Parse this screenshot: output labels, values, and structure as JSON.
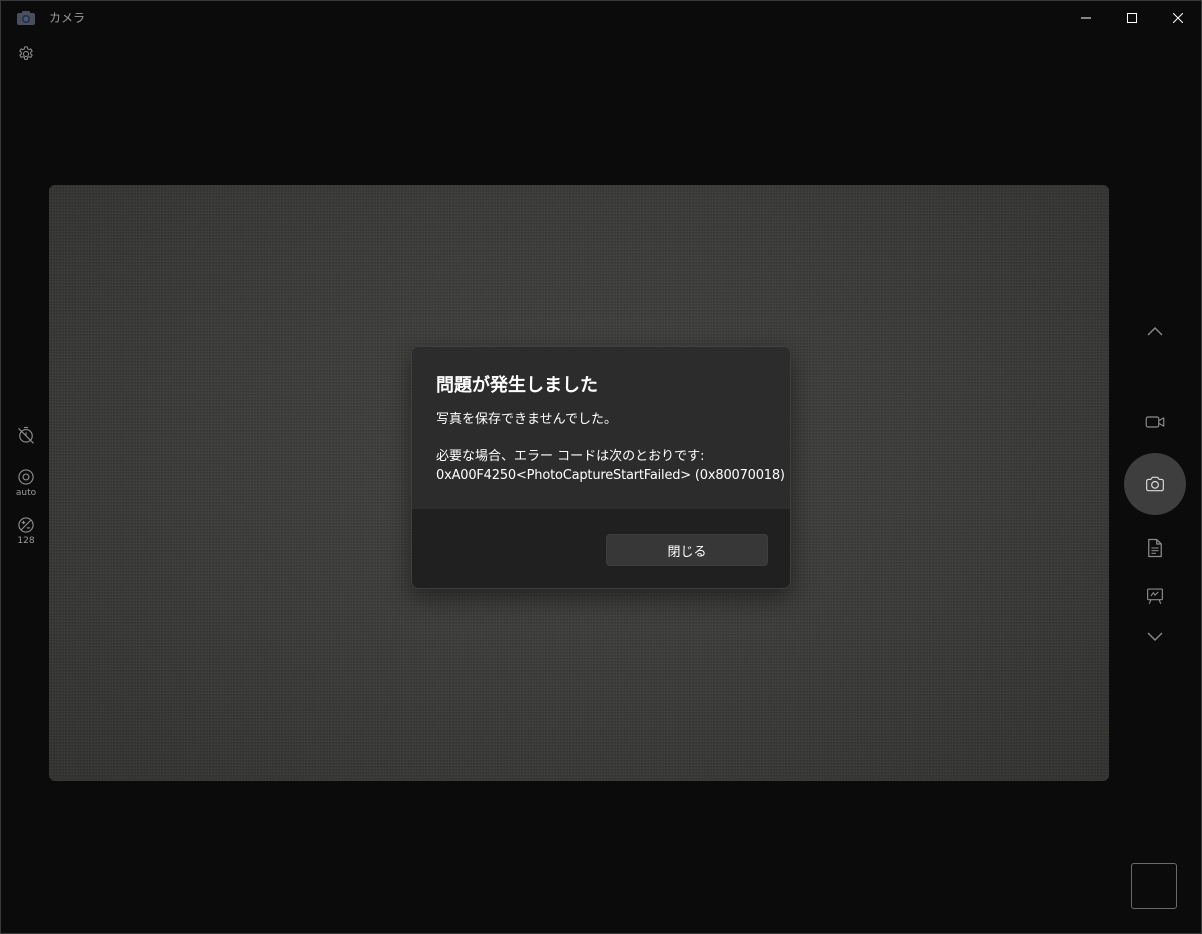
{
  "window": {
    "title": "カメラ"
  },
  "left_toolbar": {
    "timer_icon": "timer-off-icon",
    "focus_label": "auto",
    "brightness_label": "128"
  },
  "right_toolbar": {
    "modes": [
      "video-icon",
      "camera-icon",
      "document-icon",
      "whiteboard-icon"
    ],
    "active_mode": "camera-icon"
  },
  "dialog": {
    "title": "問題が発生しました",
    "message": "写真を保存できませんでした。",
    "code_intro": "必要な場合、エラー コードは次のとおりです:",
    "code": "0xA00F4250<PhotoCaptureStartFailed> (0x80070018)",
    "close_label": "閉じる"
  },
  "colors": {
    "window_bg": "#0b0b0b",
    "dialog_bg": "#2c2c2c",
    "dialog_footer_bg": "#202020",
    "button_bg": "#373737",
    "icon": "#8c8c8c"
  }
}
